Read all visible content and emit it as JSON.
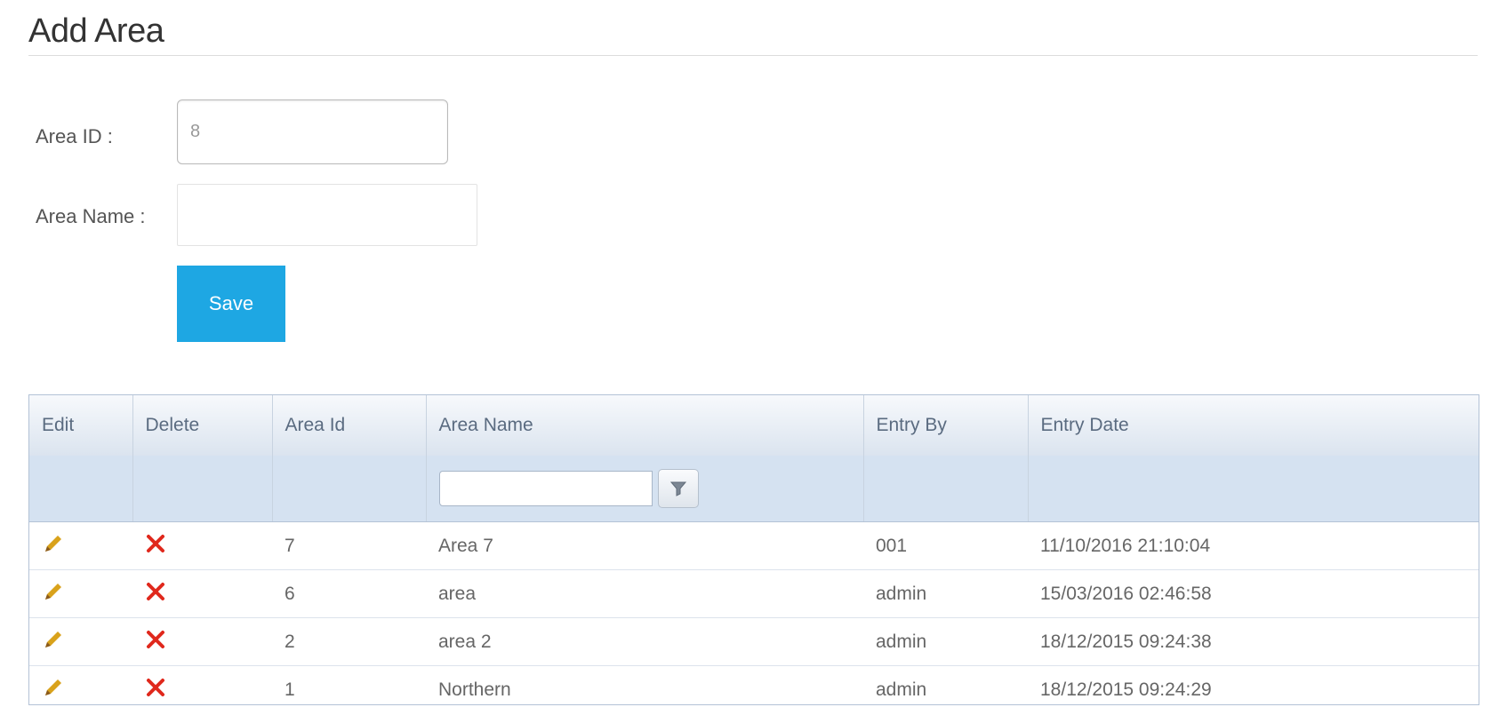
{
  "page": {
    "title": "Add Area"
  },
  "form": {
    "area_id_label": "Area ID :",
    "area_id_value": "8",
    "area_name_label": "Area Name :",
    "area_name_value": "",
    "save_label": "Save"
  },
  "grid": {
    "columns": [
      "Edit",
      "Delete",
      "Area Id",
      "Area Name",
      "Entry By",
      "Entry Date"
    ],
    "filter_value": "",
    "rows": [
      {
        "area_id": "7",
        "area_name": "Area 7",
        "entry_by": "001",
        "entry_date": "11/10/2016 21:10:04"
      },
      {
        "area_id": "6",
        "area_name": "area",
        "entry_by": "admin",
        "entry_date": "15/03/2016 02:46:58"
      },
      {
        "area_id": "2",
        "area_name": "area 2",
        "entry_by": "admin",
        "entry_date": "18/12/2015 09:24:38"
      },
      {
        "area_id": "1",
        "area_name": "Northern",
        "entry_by": "admin",
        "entry_date": "18/12/2015 09:24:29"
      }
    ]
  },
  "icons": {
    "edit": "pencil-icon",
    "delete": "delete-x-icon",
    "filter": "filter-icon"
  },
  "colors": {
    "accent": "#1ea7e3",
    "delete": "#e0281c",
    "pencil": "#d9a21b",
    "header_bg": "#dbe4ef"
  }
}
